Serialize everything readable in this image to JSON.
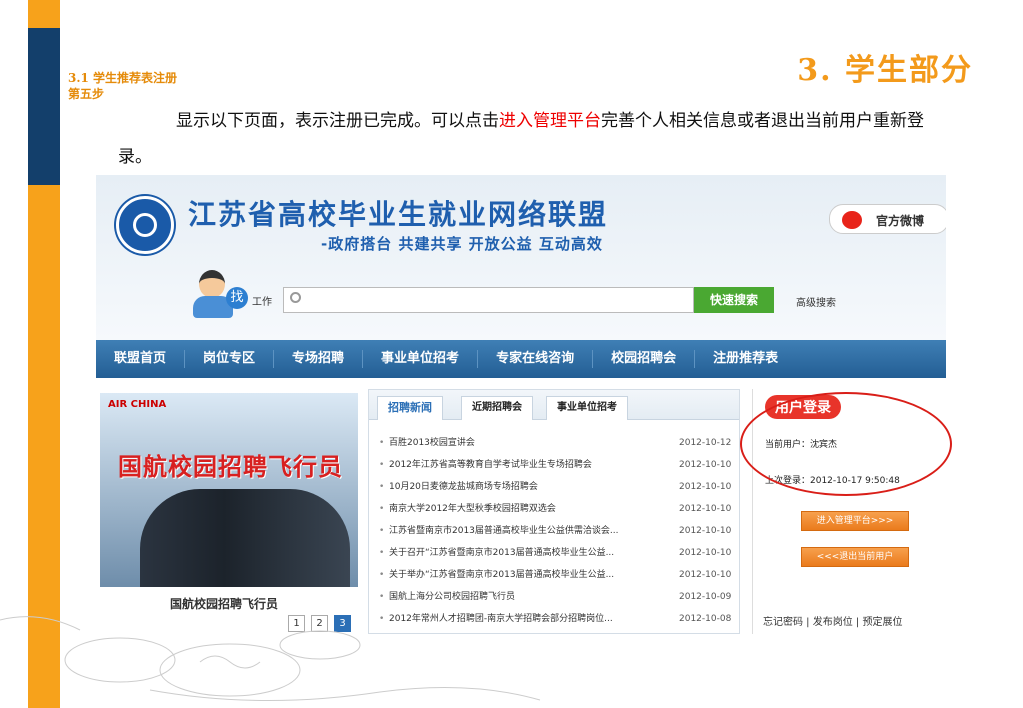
{
  "slide": {
    "title": "3. 学生部分",
    "section": "3.1 学生推荐表注册",
    "step": "第五步",
    "body_before": "显示以下页面，表示注册已完成。可以点击",
    "body_highlight": "进入管理平台",
    "body_after": "完善个人相关信息或者退出当前用户重新登录。"
  },
  "site": {
    "title": "江苏省高校毕业生就业网络联盟",
    "slogan": "-政府搭台 共建共享 开放公益 互动高效",
    "weibo_label": "官方微博",
    "search": {
      "zhao": "找",
      "category": "工作",
      "placeholder": "",
      "button": "快速搜索",
      "advanced": "高级搜索"
    },
    "nav": [
      "联盟首页",
      "岗位专区",
      "专场招聘",
      "事业单位招考",
      "专家在线咨询",
      "校园招聘会",
      "注册推荐表"
    ]
  },
  "promo": {
    "brand": "AIR CHINA",
    "title": "国航校园招聘飞行员",
    "caption": "国航校园招聘飞行员",
    "pages": [
      "1",
      "2",
      "3"
    ]
  },
  "news": {
    "tabs": [
      "招聘新闻",
      "近期招聘会",
      "事业单位招考"
    ],
    "items": [
      {
        "title": "百胜2013校园宣讲会",
        "date": "2012-10-12"
      },
      {
        "title": "2012年江苏省高等教育自学考试毕业生专场招聘会",
        "date": "2012-10-10"
      },
      {
        "title": "10月20日麦德龙盐城商场专场招聘会",
        "date": "2012-10-10"
      },
      {
        "title": "南京大学2012年大型秋季校园招聘双选会",
        "date": "2012-10-10"
      },
      {
        "title": "江苏省暨南京市2013届普通高校毕业生公益供需洽谈会...",
        "date": "2012-10-10"
      },
      {
        "title": "关于召开“江苏省暨南京市2013届普通高校毕业生公益...",
        "date": "2012-10-10"
      },
      {
        "title": "关于举办“江苏省暨南京市2013届普通高校毕业生公益...",
        "date": "2012-10-10"
      },
      {
        "title": "国航上海分公司校园招聘飞行员",
        "date": "2012-10-09"
      },
      {
        "title": "2012年常州人才招聘团-南京大学招聘会部分招聘岗位...",
        "date": "2012-10-08"
      }
    ]
  },
  "login": {
    "title": "用户登录",
    "current_user": "当前用户：沈宾杰",
    "last_login": "上次登录：2012-10-17 9:50:48",
    "enter_btn": "进入管理平台>>>",
    "logout_btn": "<<<退出当前用户",
    "links": "忘记密码 | 发布岗位 | 预定展位"
  },
  "colors": {
    "accent": "#f39a1b",
    "navy": "#133f6b",
    "highlight": "#e00000",
    "annotation": "#d91e18"
  }
}
